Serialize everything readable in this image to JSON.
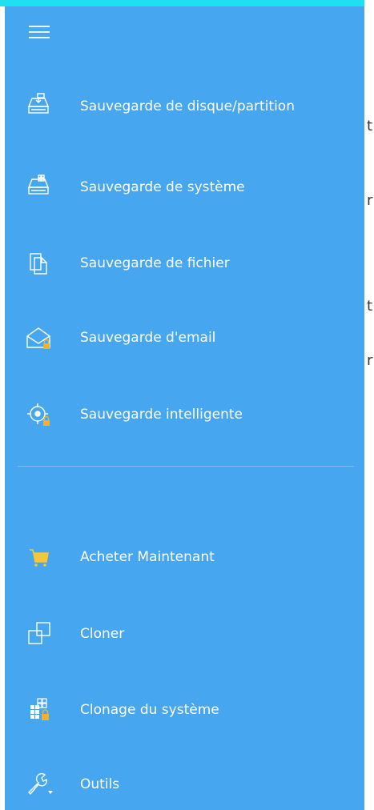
{
  "colors": {
    "sidebar_bg": "#47a6f0",
    "top_strip": "#1ee0f0",
    "text": "#ffffff",
    "lock": "#f0b030",
    "cart": "#f5c53a"
  },
  "menu": {
    "icon": "hamburger-icon"
  },
  "items_top": [
    {
      "label": "Sauvegarde de disque/partition",
      "icon": "disk-backup-icon"
    },
    {
      "label": "Sauvegarde de système",
      "icon": "system-backup-icon"
    },
    {
      "label": "Sauvegarde de fichier",
      "icon": "file-backup-icon"
    },
    {
      "label": "Sauvegarde d'email",
      "icon": "email-backup-icon",
      "locked": true
    },
    {
      "label": "Sauvegarde intelligente",
      "icon": "smart-backup-icon",
      "locked": true
    }
  ],
  "items_bottom": [
    {
      "label": "Acheter Maintenant",
      "icon": "cart-icon"
    },
    {
      "label": "Cloner",
      "icon": "clone-icon"
    },
    {
      "label": "Clonage du système",
      "icon": "system-clone-icon",
      "locked": true
    },
    {
      "label": "Outils",
      "icon": "wrench-icon"
    }
  ],
  "background_fragments": [
    "t",
    "r",
    "t",
    "r"
  ]
}
